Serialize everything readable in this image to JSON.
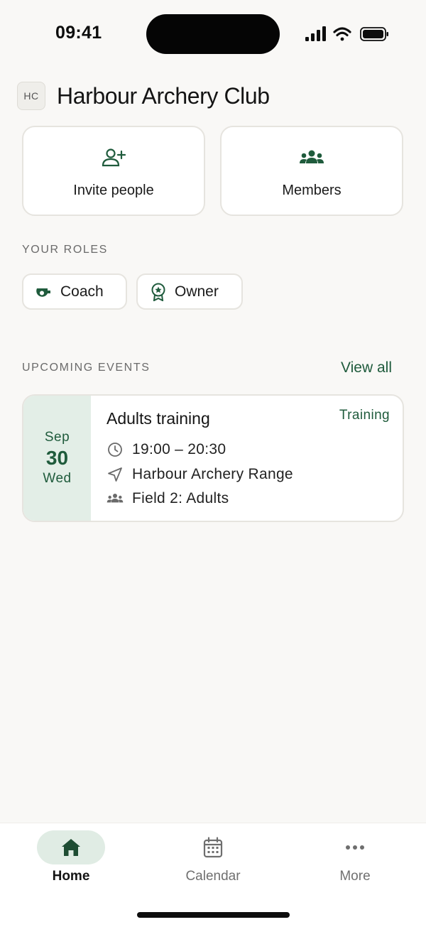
{
  "status_bar": {
    "time": "09:41",
    "icons": [
      "cellular-icon",
      "wifi-icon",
      "battery-icon"
    ]
  },
  "header": {
    "avatar_initials": "HC",
    "title": "Harbour Archery Club"
  },
  "actions": {
    "invite": {
      "label": "Invite people",
      "icon": "person-add-icon"
    },
    "members": {
      "label": "Members",
      "icon": "group-icon"
    }
  },
  "roles": {
    "heading": "YOUR ROLES",
    "items": [
      {
        "label": "Coach",
        "icon": "whistle-icon"
      },
      {
        "label": "Owner",
        "icon": "award-badge-icon"
      }
    ]
  },
  "events": {
    "heading": "UPCOMING EVENTS",
    "view_all_label": "View all",
    "items": [
      {
        "month": "Sep",
        "day": "30",
        "weekday": "Wed",
        "title": "Adults training",
        "type": "Training",
        "time": "19:00 – 20:30",
        "location": "Harbour Archery Range",
        "group": "Field 2: Adults"
      }
    ]
  },
  "tab_bar": {
    "tabs": [
      {
        "label": "Home",
        "icon": "home-icon",
        "active": true
      },
      {
        "label": "Calendar",
        "icon": "calendar-icon",
        "active": false
      },
      {
        "label": "More",
        "icon": "more-dots-icon",
        "active": false
      }
    ]
  },
  "colors": {
    "accent": "#1f5b3c",
    "accent_soft": "#e3eee7",
    "background": "#f9f8f6",
    "card_border": "#e6e4df"
  }
}
